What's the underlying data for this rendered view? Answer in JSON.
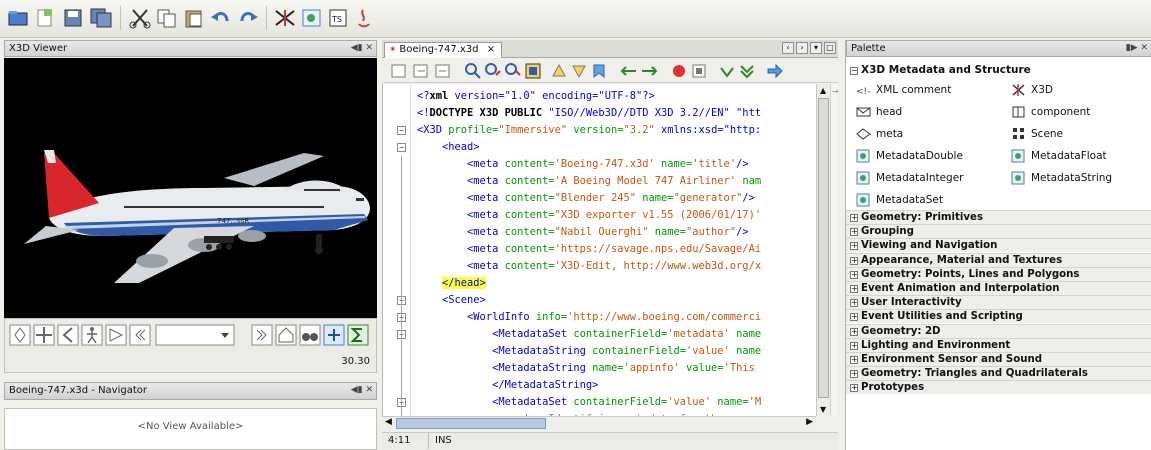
{
  "toolbar": {
    "icons": [
      "open-project-icon",
      "new-file-icon",
      "save-icon",
      "save-all-icon",
      "cut-icon",
      "copy-icon",
      "paste-icon",
      "undo-icon",
      "redo-icon",
      "x3d-icon",
      "metadata-icon",
      "ts-icon",
      "java-icon"
    ]
  },
  "viewer": {
    "title": "X3D Viewer",
    "fps": "30.30",
    "plane_label": "747...ssR"
  },
  "navigator": {
    "title": "Boeing-747.x3d - Navigator",
    "empty_text": "<No View Available>"
  },
  "editor": {
    "tab_label": "Boeing-747.x3d",
    "tab_close": "×",
    "lines": [
      {
        "pre": "<?",
        "k": "xml",
        "rest": " version=\"1.0\" encoding=\"UTF-8\"?>"
      },
      {
        "pre": "<!",
        "k": "DOCTYPE X3D PUBLIC",
        "rest": " \"ISO//Web3D//DTD X3D 3.2//EN\" \"htt"
      },
      {
        "tag": "<X3D",
        "attr": " profile=",
        "val": "\"Immersive\"",
        "attr2": " version=",
        "val2": "\"3.2\"",
        "rest": " xmlns:xsd=\"http:"
      },
      {
        "tag": "<head>"
      },
      {
        "tag": "<meta",
        "attr": " content=",
        "val": "'Boeing-747.x3d'",
        "attr2": " name=",
        "val2": "'title'",
        "rest": "/>"
      },
      {
        "tag": "<meta",
        "attr": " content=",
        "val": "'A Boeing Model 747 Airliner'",
        "attr2": " nam",
        "val2": "",
        "rest": ""
      },
      {
        "tag": "<meta",
        "attr": " content=",
        "val": "\"Blender 245\"",
        "attr2": " name=",
        "val2": "\"generator\"",
        "rest": "/>"
      },
      {
        "tag": "<meta",
        "attr": " content=",
        "val": "\"X3D exporter v1.55 (2006/01/17)'",
        "attr2": "",
        "val2": "",
        "rest": ""
      },
      {
        "tag": "<meta",
        "attr": " content=",
        "val": "\"Nabil Ouerghi\"",
        "attr2": " name=",
        "val2": "\"author\"",
        "rest": "/>"
      },
      {
        "tag": "<meta",
        "attr": " content=",
        "val": "'https://savage.nps.edu/Savage/Ai",
        "attr2": "",
        "val2": "",
        "rest": ""
      },
      {
        "tag": "<meta",
        "attr": " content=",
        "val": "'X3D-Edit, http://www.web3d.org/x",
        "attr2": "",
        "val2": "",
        "rest": ""
      },
      {
        "tag": "</head>",
        "highlight": true
      },
      {
        "tag": "<Scene>"
      },
      {
        "tag": "<WorldInfo",
        "attr": " info=",
        "val": "'http://www.boeing.com/commerci",
        "attr2": "",
        "val2": "",
        "rest": ""
      },
      {
        "tag": "<MetadataSet",
        "attr": " containerField=",
        "val": "'metadata'",
        "attr2": " name",
        "val2": "",
        "rest": ""
      },
      {
        "tag": "<MetadataString",
        "attr": " containerField=",
        "val": "'value'",
        "attr2": " name",
        "val2": "",
        "rest": ""
      },
      {
        "tag": "<MetadataString",
        "attr": " name=",
        "val": "'appinfo'",
        "attr2": " value=",
        "val2": "'This",
        "rest": ""
      },
      {
        "tag": "</MetadataString>"
      },
      {
        "tag": "<MetadataSet",
        "attr": " containerField=",
        "val": "'value'",
        "attr2": " name=",
        "val2": "'M",
        "rest": ""
      },
      {
        "comment": "<!-- Identifying metadata for the curre"
      }
    ]
  },
  "status": {
    "position": "4:11",
    "mode": "INS"
  },
  "palette": {
    "title": "Palette",
    "open_category": "X3D Metadata and Structure",
    "items": [
      {
        "label": "XML comment",
        "icon": "xml-comment-icon"
      },
      {
        "label": "X3D",
        "icon": "x3d-node-icon"
      },
      {
        "label": "head",
        "icon": "head-icon"
      },
      {
        "label": "component",
        "icon": "component-icon"
      },
      {
        "label": "meta",
        "icon": "meta-icon"
      },
      {
        "label": "Scene",
        "icon": "scene-icon"
      },
      {
        "label": "MetadataDouble",
        "icon": "metadata-double-icon"
      },
      {
        "label": "MetadataFloat",
        "icon": "metadata-float-icon"
      },
      {
        "label": "MetadataInteger",
        "icon": "metadata-integer-icon"
      },
      {
        "label": "MetadataString",
        "icon": "metadata-string-icon"
      },
      {
        "label": "MetadataSet",
        "icon": "metadata-set-icon"
      }
    ],
    "categories": [
      "Geometry: Primitives",
      "Grouping",
      "Viewing and Navigation",
      "Appearance, Material and Textures",
      "Geometry: Points, Lines and Polygons",
      "Event Animation and Interpolation",
      "User Interactivity",
      "Event Utilities and Scripting",
      "Geometry: 2D",
      "Lighting and Environment",
      "Environment Sensor and Sound",
      "Geometry: Triangles and Quadrilaterals",
      "Prototypes"
    ]
  }
}
